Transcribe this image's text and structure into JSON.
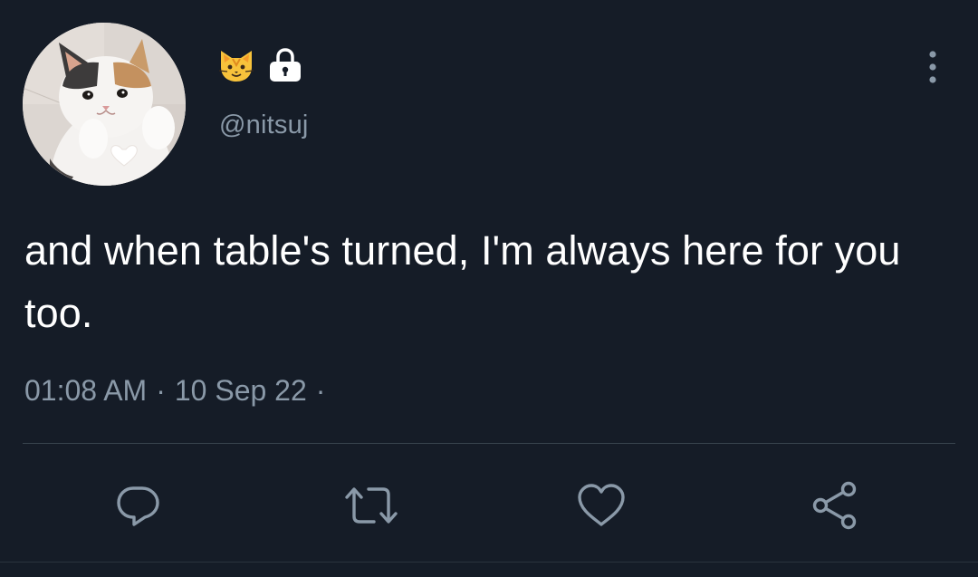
{
  "tweet": {
    "handle": "@nitsuj",
    "name_emoji": "cat-face-icon",
    "protected_icon": "lock-icon",
    "text": "and when table's turned, I'm always here for you too.",
    "time": "01:08 AM",
    "date": "10 Sep 22",
    "separator": "·"
  },
  "actions": [
    {
      "icon": "reply-icon"
    },
    {
      "icon": "retweet-icon"
    },
    {
      "icon": "like-icon"
    },
    {
      "icon": "share-icon"
    }
  ],
  "colors": {
    "background": "#151c27",
    "text": "#ffffff",
    "secondary_text": "#8a99a8",
    "divider": "#38444d"
  }
}
